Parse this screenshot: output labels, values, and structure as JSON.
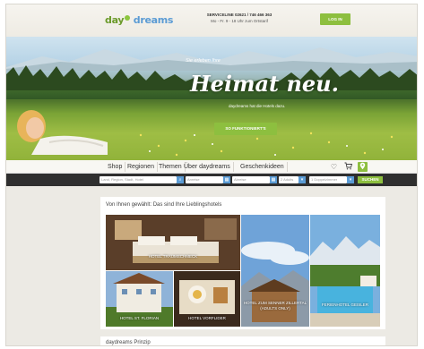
{
  "header": {
    "logo_day": "day",
    "logo_dreams": "dreams",
    "service_title": "SERVICELINE 02621 / 746 466 363",
    "service_hours": "Mo - Fr. 9 - 18 Uhr zum Ortstarif",
    "login_label": "LOG IN"
  },
  "hero": {
    "subtitle": "Sie erleben Ihre",
    "title": "Heimat neu.",
    "tagline": "daydreams hat die Hotels dazu.",
    "cta_label": "SO FUNKTIONIERT'S"
  },
  "nav": {
    "items": [
      "Shop",
      "Regionen",
      "Themen",
      "Über daydreams",
      "Geschenkideen"
    ],
    "icons": [
      "heart-icon",
      "cart-icon",
      "location-pin-icon"
    ]
  },
  "search": {
    "destination_placeholder": "Land, Region, Stadt, Hotel",
    "arrival_placeholder": "Anreise",
    "departure_placeholder": "Abreise",
    "adults_value": "2 Adults",
    "rooms_value": "1 Doppelzimmer",
    "submit_label": "SUCHEN"
  },
  "favorites": {
    "title": "Von Ihnen gewählt: Das sind Ihre Lieblingshotels",
    "hotels": [
      "HOTEL TRAUMSCHMECK",
      "HOTEL ST. FLORIAN",
      "HOTEL VORFLIDER",
      "HOTEL ZUM SENNER ZILLERTAL (ADULTS ONLY)",
      "FERIENHOTEL GEISLER"
    ]
  },
  "principle": {
    "title": "daydreams Prinzip"
  },
  "colors": {
    "accent_green": "#8dbf3f",
    "accent_blue": "#5a9bd4",
    "searchbar_dark": "#2f2f2f"
  }
}
